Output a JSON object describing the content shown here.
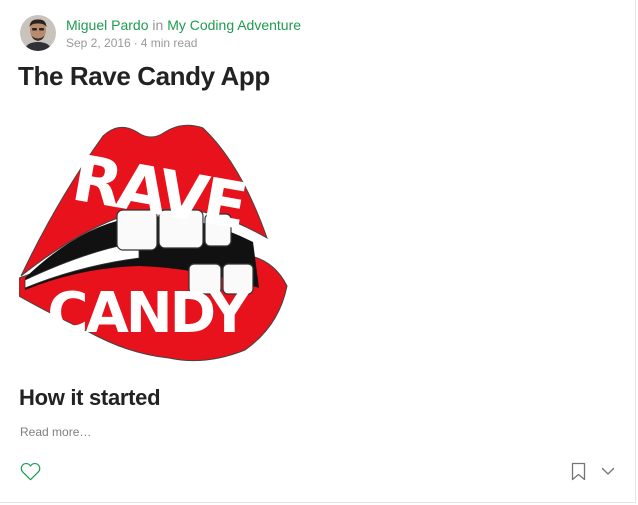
{
  "author": {
    "name": "Miguel Pardo",
    "in_word": "in",
    "publication": "My Coding Adventure",
    "date": "Sep 2, 2016",
    "separator": "·",
    "read_time": "4 min read"
  },
  "post": {
    "title": "The Rave Candy App",
    "logo_text_top": "RAVE",
    "logo_text_bottom": "CANDY",
    "subtitle": "How it started",
    "read_more": "Read more…"
  },
  "actions": {
    "like_icon": "heart-outline-icon",
    "bookmark_icon": "bookmark-outline-icon",
    "more_icon": "chevron-down-icon"
  },
  "colors": {
    "accent_green": "#1e9c4f",
    "logo_red": "#e8121c",
    "text_dark": "#222222",
    "text_muted": "#999999"
  }
}
